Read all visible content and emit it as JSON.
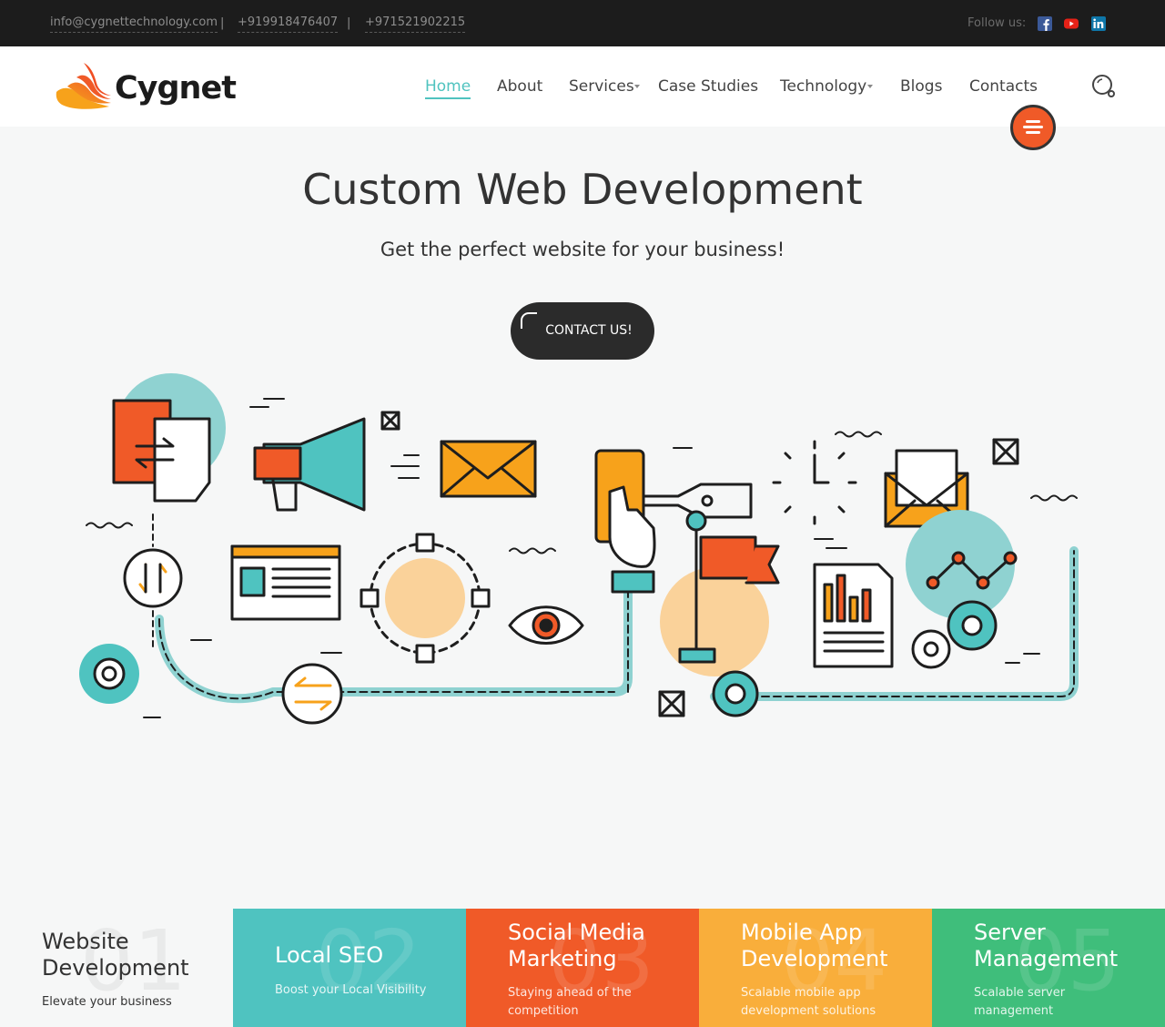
{
  "topbar": {
    "email": "info@cygnettechnology.com",
    "phone1": "+919918476407",
    "phone2": "+971521902215",
    "separator": "|",
    "follow_label": "Follow us:",
    "social": [
      {
        "icon": "facebook-icon",
        "color": "#3b5998"
      },
      {
        "icon": "youtube-icon",
        "color": "#e62117"
      },
      {
        "icon": "linkedin-icon",
        "color": "#0e76a8"
      }
    ]
  },
  "header": {
    "logo_text": "Cygnet",
    "nav": [
      {
        "label": "Home",
        "active": true
      },
      {
        "label": "About"
      },
      {
        "label": "Services",
        "dropdown": true
      },
      {
        "label": "Case Studies"
      },
      {
        "label": "Technology",
        "dropdown": true
      },
      {
        "label": "Blogs"
      },
      {
        "label": "Contacts"
      }
    ]
  },
  "hero": {
    "title": "Custom Web Development",
    "subtitle": "Get the perfect website for your business!",
    "cta_label": "CONTACT US!"
  },
  "services": [
    {
      "num": "01",
      "title_line1": "Website",
      "title_line2": "Development",
      "subtitle": "Elevate your business",
      "color": "#f6f7f7"
    },
    {
      "num": "02",
      "title_line1": "Local SEO",
      "title_line2": "",
      "subtitle": "Boost your Local Visibility",
      "color": "#4fc3c0"
    },
    {
      "num": "03",
      "title_line1": "Social Media",
      "title_line2": "Marketing",
      "subtitle": "Staying ahead of the competition",
      "color": "#f05a28"
    },
    {
      "num": "04",
      "title_line1": "Mobile App",
      "title_line2": "Development",
      "subtitle": "Scalable mobile app development solutions",
      "color": "#f9ae3b"
    },
    {
      "num": "05",
      "title_line1": "Server",
      "title_line2": "Management",
      "subtitle": "Scalable server management",
      "color": "#3fbe7b"
    }
  ],
  "colors": {
    "accent": "#4fc3bf",
    "orange": "#f05a28",
    "dark": "#2b2b2b"
  }
}
